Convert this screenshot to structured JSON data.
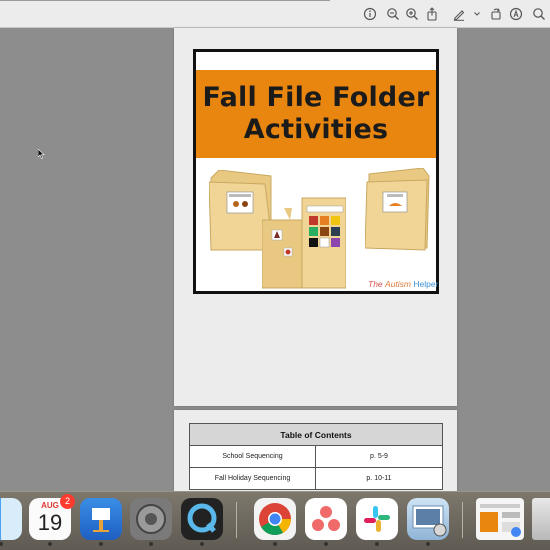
{
  "toolbar": {
    "buttons": [
      "info-icon",
      "zoom-out-icon",
      "zoom-in-icon",
      "share-icon",
      "markup-icon",
      "chevron-down-icon",
      "rotate-icon",
      "annotate-icon",
      "search-icon"
    ]
  },
  "cover": {
    "title_line1": "Fall File Folder",
    "title_line2": "Activities",
    "brand_part1": "The",
    "brand_part2": "Autism",
    "brand_part3": "Helper"
  },
  "toc": {
    "header": "Table of Contents",
    "rows": [
      {
        "title": "School Sequencing",
        "page": "p. 5-9"
      },
      {
        "title": "Fall Holiday Sequencing",
        "page": "p. 10-11"
      }
    ]
  },
  "dock": {
    "calendar_month": "AUG",
    "calendar_day": "19",
    "calendar_badge": "2",
    "apps": [
      "finder-icon",
      "calendar-icon",
      "keynote-icon",
      "system-preferences-icon",
      "quicktime-icon",
      "chrome-icon",
      "asana-icon",
      "slack-icon",
      "preview-icon",
      "window-thumbnail-icon",
      "trash-icon"
    ]
  },
  "colors": {
    "banner": "#e8860f",
    "folder": "#f0d597",
    "workspace": "#8d8d8d"
  }
}
